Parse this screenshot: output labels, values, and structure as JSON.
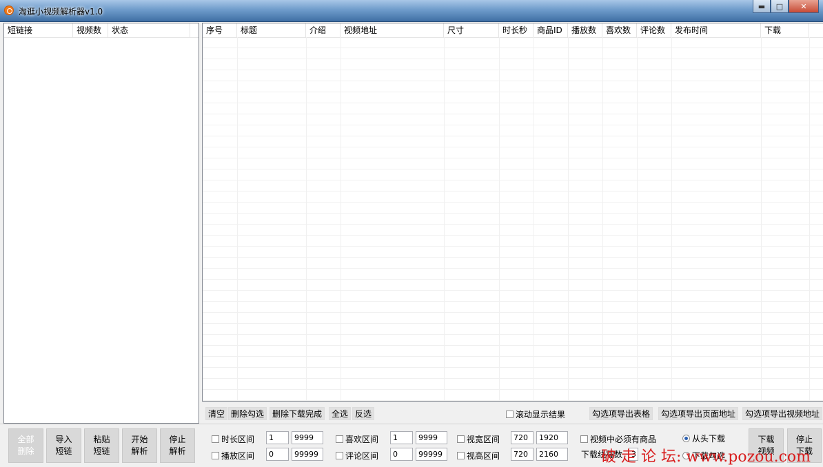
{
  "window": {
    "title": "淘逛小视频解析器v1.0",
    "minimize": "▬",
    "maximize": "□",
    "close": "✕"
  },
  "left_list": {
    "columns": [
      "短链接",
      "视频数",
      "状态"
    ]
  },
  "video_table": {
    "columns": [
      "序号",
      "标题",
      "介绍",
      "视频地址",
      "尺寸",
      "时长秒",
      "商品ID",
      "播放数",
      "喜欢数",
      "评论数",
      "发布时间",
      "下载"
    ]
  },
  "actions": {
    "clear": "清空",
    "delete_checked": "删除勾选",
    "delete_downloaded": "删除下载完成",
    "select_all": "全选",
    "invert": "反选",
    "scroll_results": "滚动显示结果",
    "export_table": "勾选项导出表格",
    "export_page_urls": "勾选项导出页面地址",
    "export_video_urls": "勾选项导出视频地址"
  },
  "left_buttons": {
    "delete_all": [
      "全部",
      "删除"
    ],
    "import": [
      "导入",
      "短链"
    ],
    "paste": [
      "粘贴",
      "短链"
    ],
    "start": [
      "开始",
      "解析"
    ],
    "stop": [
      "停止",
      "解析"
    ]
  },
  "filters": {
    "duration": {
      "label": "时长区间",
      "min": "1",
      "max": "9999"
    },
    "plays": {
      "label": "播放区间",
      "min": "0",
      "max": "99999"
    },
    "likes": {
      "label": "喜欢区间",
      "min": "1",
      "max": "9999"
    },
    "comments": {
      "label": "评论区间",
      "min": "0",
      "max": "99999"
    },
    "width": {
      "label": "视宽区间",
      "min": "720",
      "max": "1920"
    },
    "height": {
      "label": "视高区间",
      "min": "720",
      "max": "2160"
    },
    "must_have_product": "视频中必须有商品",
    "download_threads_label": "下载线程数",
    "download_threads": "3"
  },
  "download": {
    "from_start": "从头下载",
    "download_checked": "下载勾选",
    "download_button": [
      "下载",
      "视频"
    ],
    "stop_button": [
      "停止",
      "下载"
    ]
  },
  "watermark": "破 走 论 坛: www.pozou.com"
}
